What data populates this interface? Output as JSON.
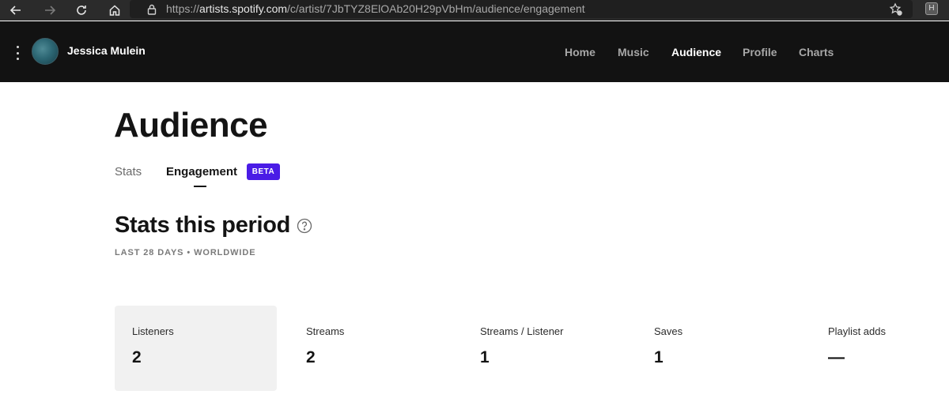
{
  "browser": {
    "url_prefix": "https://",
    "url_host": "artists.spotify.com",
    "url_path": "/c/artist/7JbTYZ8ElOAb20H29pVbHm/audience/engagement"
  },
  "header": {
    "artist_name": "Jessica Mulein",
    "nav": [
      "Home",
      "Music",
      "Audience",
      "Profile",
      "Charts"
    ],
    "active_nav": "Audience"
  },
  "page": {
    "title": "Audience",
    "tabs": [
      "Stats",
      "Engagement"
    ],
    "active_tab": "Engagement",
    "badge": "BETA",
    "section_title": "Stats this period",
    "section_subtitle": "LAST 28 DAYS • WORLDWIDE"
  },
  "stats": [
    {
      "label": "Listeners",
      "value": "2"
    },
    {
      "label": "Streams",
      "value": "2"
    },
    {
      "label": "Streams / Listener",
      "value": "1"
    },
    {
      "label": "Saves",
      "value": "1"
    },
    {
      "label": "Playlist adds",
      "value": "—"
    }
  ],
  "colors": {
    "header_bg": "#121212",
    "accent_beta": "#4a1ce6",
    "selected_card": "#f1f1f1"
  }
}
